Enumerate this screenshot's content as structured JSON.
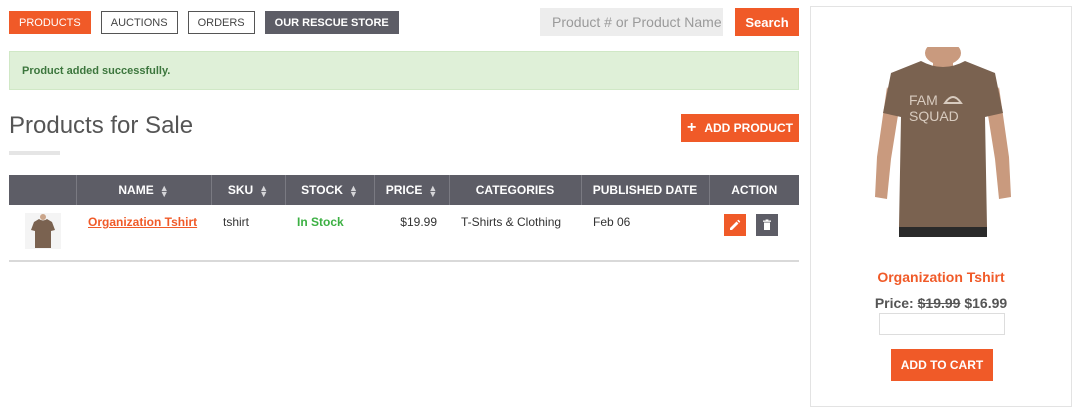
{
  "nav": {
    "tabs": [
      {
        "label": "PRODUCTS"
      },
      {
        "label": "AUCTIONS"
      },
      {
        "label": "ORDERS"
      },
      {
        "label": "OUR RESCUE STORE"
      }
    ]
  },
  "search": {
    "placeholder": "Product # or Product Name",
    "button_label": "Search"
  },
  "alert": {
    "message": "Product added successfully."
  },
  "page": {
    "title": "Products for Sale",
    "add_button_label": "ADD PRODUCT"
  },
  "table": {
    "headers": [
      "",
      "NAME",
      "SKU",
      "STOCK",
      "PRICE",
      "CATEGORIES",
      "PUBLISHED DATE",
      "ACTION"
    ],
    "rows": [
      {
        "image": "tshirt-thumbnail",
        "name": "Organization Tshirt",
        "sku": "tshirt",
        "stock": "In Stock",
        "price": "$19.99",
        "categories": "T-Shirts & Clothing",
        "published": "Feb 06"
      }
    ]
  },
  "preview": {
    "name": "Organization Tshirt",
    "price_label": "Price: ",
    "old_price": "$19.99",
    "new_price": "$16.99",
    "qty_value": "",
    "cart_label": "ADD TO CART",
    "shirt_text_line1": "FAM",
    "shirt_text_line2": "SQUAD"
  },
  "colors": {
    "accent": "#f05a28",
    "header_dark": "#5d5d66",
    "success_bg": "#dff0d8",
    "stock_green": "#3cb043"
  }
}
